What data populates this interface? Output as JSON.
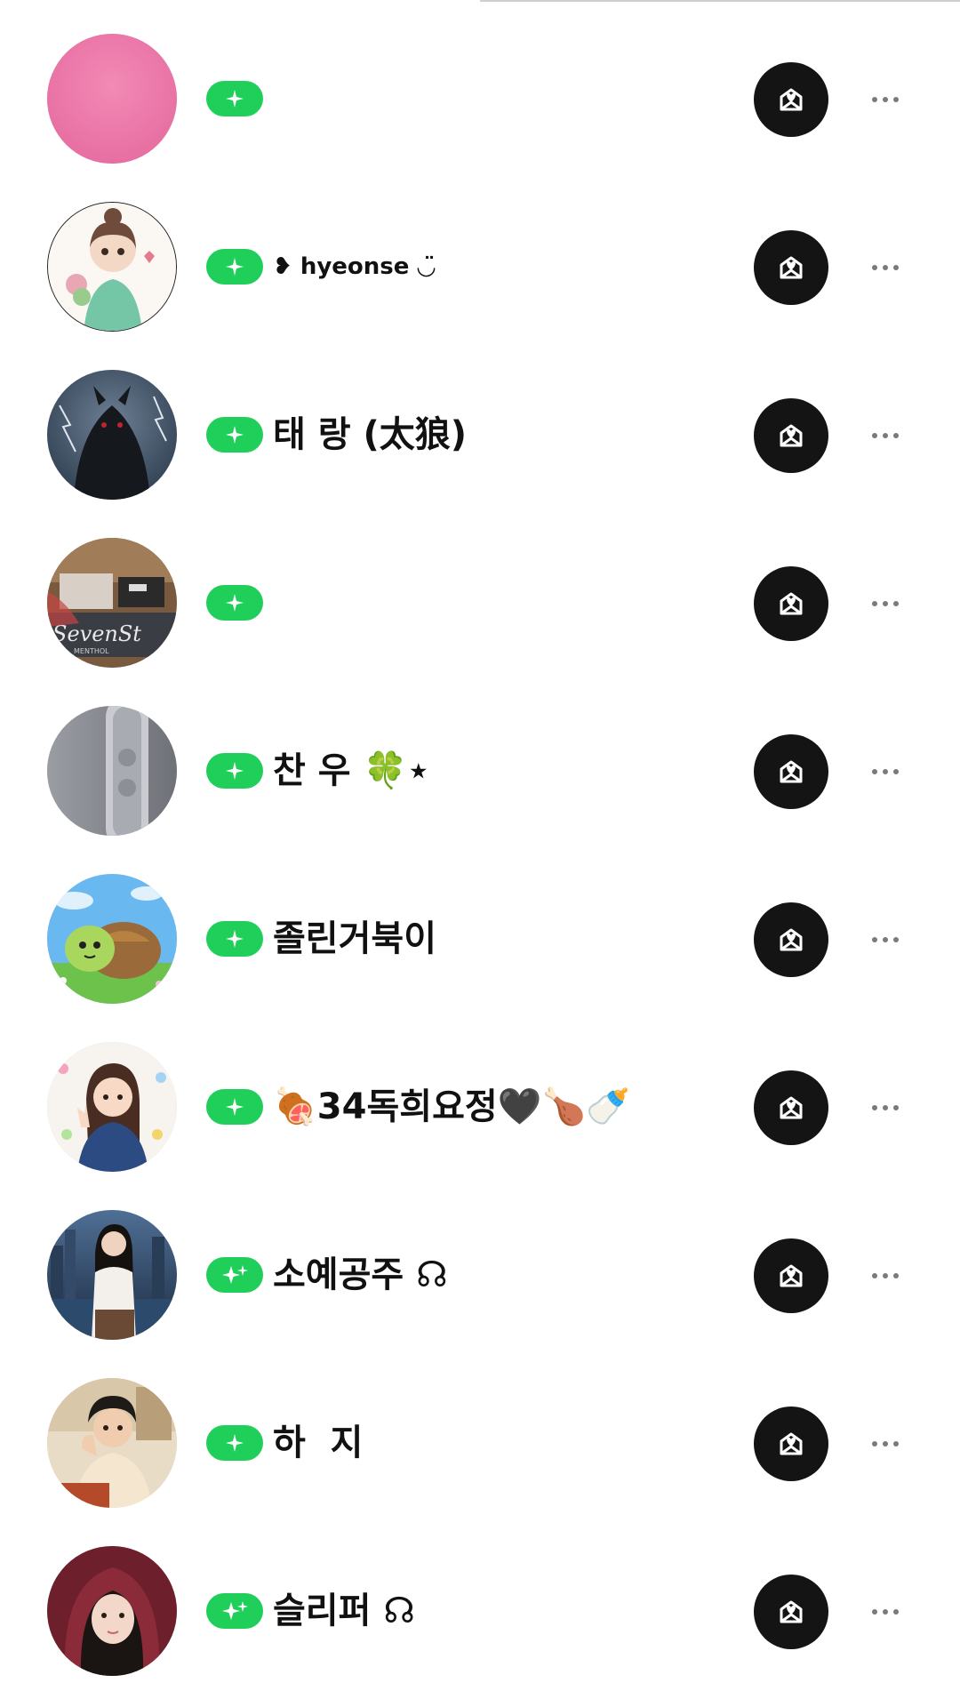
{
  "accent_color": "#1fcf5a",
  "icons": {
    "badge": "sparkle-icon",
    "action": "gift-envelope-icon",
    "more": "more-dots-icon"
  },
  "users": [
    {
      "name": "",
      "avatar": "pink-circle",
      "badge": "single"
    },
    {
      "name": "❥ hyeonse ◡̈",
      "avatar": "illustrated-girl-with-flowers",
      "badge": "single"
    },
    {
      "name": "태 랑 (太狼)",
      "avatar": "black-wolf-lightning",
      "badge": "single"
    },
    {
      "name": "",
      "avatar": "cigarette-pack-photo",
      "badge": "single"
    },
    {
      "name": "찬 우 🍀⋆",
      "avatar": "gray-phone-closeup",
      "badge": "single"
    },
    {
      "name": "졸린거북이",
      "avatar": "cartoon-turtle-grass",
      "badge": "single"
    },
    {
      "name": "🍖34독희요정🖤🍗🍼",
      "avatar": "illustrated-girl-peace-sign",
      "badge": "single"
    },
    {
      "name": "소예공주 ☊",
      "avatar": "woman-city-night",
      "badge": "double"
    },
    {
      "name": "하  지",
      "avatar": "illustrated-man-cafe",
      "badge": "single"
    },
    {
      "name": "슬리퍼 ☊",
      "avatar": "woman-red-hood",
      "badge": "double"
    }
  ]
}
